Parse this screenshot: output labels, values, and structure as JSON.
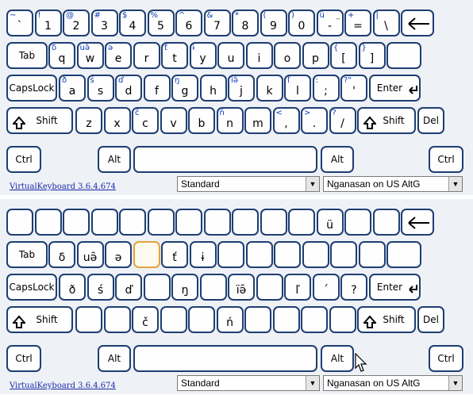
{
  "version_link": "VirtualKeyboard 3.6.4.674",
  "layout_select": "Standard",
  "language_select": "Nganasan on US AltG",
  "icons": {
    "backspace": "left-arrow-icon",
    "tab": "tab-icon",
    "enter": "enter-arrow-icon",
    "shift": "shift-arrow-icon",
    "dropdown": "chevron-down-icon",
    "cursor": "mouse-pointer-icon"
  },
  "top_keyboard": {
    "row1": [
      {
        "base": "`",
        "shift": "~"
      },
      {
        "base": "1",
        "shift": "!"
      },
      {
        "base": "2",
        "shift": "@"
      },
      {
        "base": "3",
        "shift": "#"
      },
      {
        "base": "4",
        "shift": "$"
      },
      {
        "base": "5",
        "shift": "%"
      },
      {
        "base": "6",
        "shift": "^"
      },
      {
        "base": "7",
        "shift": "&"
      },
      {
        "base": "8",
        "shift": "*"
      },
      {
        "base": "9",
        "shift": "("
      },
      {
        "base": "0",
        "shift": ")"
      },
      {
        "base": "-",
        "shift": "ü",
        "alt": "_"
      },
      {
        "base": "=",
        "shift": "+"
      },
      {
        "base": "\\",
        "shift": "|"
      }
    ],
    "row2": [
      {
        "base": "q",
        "shift": "δ"
      },
      {
        "base": "w",
        "shift": "uə̑"
      },
      {
        "base": "e",
        "shift": "ə"
      },
      {
        "base": "r",
        "shift": ""
      },
      {
        "base": "t",
        "shift": "ť"
      },
      {
        "base": "y",
        "shift": "ɨ"
      },
      {
        "base": "u",
        "shift": ""
      },
      {
        "base": "i",
        "shift": ""
      },
      {
        "base": "o",
        "shift": ""
      },
      {
        "base": "p",
        "shift": ""
      },
      {
        "base": "[",
        "shift": "{"
      },
      {
        "base": "]",
        "shift": "}"
      }
    ],
    "row3": [
      {
        "base": "a",
        "shift": "ð"
      },
      {
        "base": "s",
        "shift": "ś"
      },
      {
        "base": "d",
        "shift": "ď"
      },
      {
        "base": "f",
        "shift": ""
      },
      {
        "base": "g",
        "shift": "ŋ"
      },
      {
        "base": "h",
        "shift": ""
      },
      {
        "base": "j",
        "shift": "ïə̑"
      },
      {
        "base": "k",
        "shift": ""
      },
      {
        "base": "l",
        "shift": "ľ"
      },
      {
        "base": ";",
        "shift": ":"
      },
      {
        "base": "'",
        "shift": "?\""
      }
    ],
    "row4": [
      {
        "base": "z",
        "shift": ""
      },
      {
        "base": "x",
        "shift": ""
      },
      {
        "base": "c",
        "shift": "č"
      },
      {
        "base": "v",
        "shift": ""
      },
      {
        "base": "b",
        "shift": ""
      },
      {
        "base": "n",
        "shift": "ń"
      },
      {
        "base": "m",
        "shift": ""
      },
      {
        "base": ",",
        "shift": "<"
      },
      {
        "base": ".",
        "shift": ">"
      },
      {
        "base": "/",
        "shift": "?"
      }
    ]
  },
  "bottom_keyboard": {
    "row1": [
      "",
      "",
      "",
      "",
      "",
      "",
      "",
      "",
      "",
      "",
      "",
      "ü",
      "",
      ""
    ],
    "row2": [
      "δ",
      "uə̑",
      "ə",
      "",
      "ť",
      "ɨ",
      "",
      "",
      "",
      "",
      "",
      ""
    ],
    "row3": [
      "ð",
      "ś",
      "ď",
      "",
      "ŋ",
      "",
      "ïə̑",
      "",
      "ľ",
      "´",
      "?"
    ],
    "row4": [
      "",
      "",
      "č",
      "",
      "",
      "ń",
      "",
      "",
      "",
      ""
    ]
  },
  "mod_keys": {
    "tab": "Tab",
    "capslock": "CapsLock",
    "enter": "Enter",
    "shift": "Shift",
    "del": "Del",
    "ctrl": "Ctrl",
    "alt": "Alt"
  },
  "colors": {
    "key_border": "#1e3e72",
    "shift_char": "#0a3cb8",
    "altgr_char": "#2a8a1e",
    "highlight": "#e2a33a"
  }
}
